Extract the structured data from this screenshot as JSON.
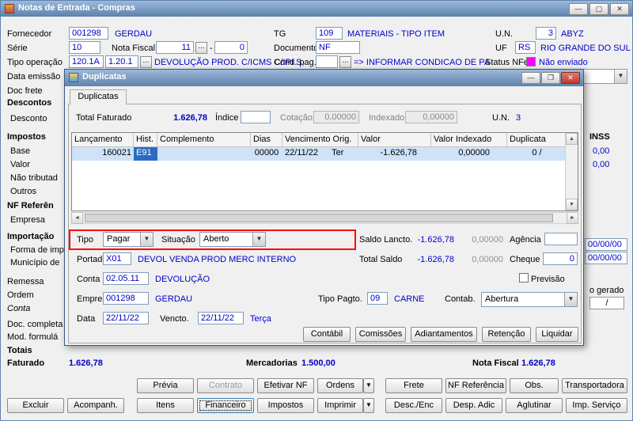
{
  "icons": {
    "dropdown": "▼",
    "browse": "...",
    "minimize": "—",
    "maximize": "▢",
    "restore": "❐",
    "close": "✕",
    "scroll_up": "▲",
    "scroll_down": "▼",
    "scroll_left": "◄",
    "scroll_right": "►"
  },
  "colors": {
    "titlebar": "#5c82ad",
    "value_blue": "#0000cc",
    "status_nfe_magenta": "#ff00ff",
    "grid_selection": "#cfe2f7",
    "annotation_red": "#ff0000"
  },
  "window": {
    "title": "Notas de Entrada - Compras"
  },
  "header": {
    "fornecedor_label": "Fornecedor",
    "fornecedor_code": "001298",
    "fornecedor_name": "GERDAU",
    "tg_label": "TG",
    "tg_code": "109",
    "tg_desc": "MATERIAIS - TIPO ITEM",
    "un_label": "U.N.",
    "un_code": "3",
    "un_desc": "ABYZ",
    "serie_label": "Série",
    "serie_value": "10",
    "nf_label": "Nota Fiscal",
    "nf_value": "11",
    "nf_sep": "-",
    "nf_value2": "0",
    "documento_label": "Documento",
    "documento_value": "NF",
    "uf_label": "UF",
    "uf_code": "RS",
    "uf_desc": "RIO GRANDE DO SUL",
    "tipo_op_label": "Tipo operação",
    "tipo_op_code1": "120.1A",
    "tipo_op_code2": "1.20.1",
    "tipo_op_desc": "DEVOLUÇÃO PROD. C/ICMS C/IPI S,",
    "cond_pag_label": "Cond. pag.",
    "cond_pag_desc": "=> INFORMAR CONDICAO DE PA",
    "status_nfe_label": "Status NFe",
    "status_nfe_value": "Não enviado",
    "data_emissao_label": "Data emissão",
    "doc_frete_label": "Doc frete"
  },
  "sidebar": {
    "descontos": "Descontos",
    "desconto": "Desconto",
    "impostos": "Impostos",
    "base": "Base",
    "valor": "Valor",
    "nao_tributad": "Não tributad",
    "outros": "Outros",
    "nf_referen": "NF Referên",
    "empresa": "Empresa",
    "importacao": "Importação",
    "forma_imp": "Forma de imp",
    "municipio": "Município de",
    "remessa": "Remessa",
    "ordem": "Ordem",
    "conta": "Conta",
    "doc_completa": "Doc. completa",
    "mod_formula": "Mod. formulá"
  },
  "right_edge": {
    "inss": "INSS",
    "val1": "0,00",
    "val2": "0,00",
    "date1": "00/00/00",
    "date2": "00/00/00",
    "gerado": "o gerado",
    "slash": "/"
  },
  "totals": {
    "totais": "Totais",
    "faturado_label": "Faturado",
    "faturado_value": "1.626,78",
    "mercadorias_label": "Mercadorias",
    "mercadorias_value": "1.500,00",
    "nota_fiscal_label": "Nota Fiscal",
    "nota_fiscal_value": "1.626,78"
  },
  "buttons_row1": [
    {
      "label": "Prévia"
    },
    {
      "label": "Contrato",
      "disabled": true
    },
    {
      "label": "Efetivar NF"
    },
    {
      "label": "Ordens",
      "split": true
    },
    {
      "label": "Frete"
    },
    {
      "label": "NF Referência"
    },
    {
      "label": "Obs."
    },
    {
      "label": "Transportadora"
    }
  ],
  "buttons_row2": [
    {
      "label": "Excluir"
    },
    {
      "label": "Acompanh."
    },
    {
      "label": "Itens"
    },
    {
      "label": "Financeiro",
      "focused": true
    },
    {
      "label": "Impostos"
    },
    {
      "label": "Imprimir",
      "split": true
    },
    {
      "label": "Desc./Enc"
    },
    {
      "label": "Desp. Adic"
    },
    {
      "label": "Aglutinar"
    },
    {
      "label": "Imp. Serviço"
    }
  ],
  "dialog": {
    "title": "Duplicatas",
    "tab": "Duplicatas",
    "summary": {
      "total_faturado_label": "Total Faturado",
      "total_faturado_value": "1.626,78",
      "indice_label": "Índice",
      "indice_value": "",
      "cotacao_label": "Cotação",
      "cotacao_value": "0,00000",
      "indexado_label": "Indexado",
      "indexado_value": "0,00000",
      "un_label": "U.N.",
      "un_value": "3"
    },
    "grid": {
      "columns": [
        "Lançamento",
        "Hist.",
        "Complemento",
        "Dias",
        "Vencimento Orig.",
        "Valor",
        "Valor Indexado",
        "Duplicata"
      ],
      "row": {
        "lancamento": "160021",
        "hist": "E91",
        "complemento": "",
        "dias": "00000",
        "vencimento": "22/11/22",
        "weekday": "Ter",
        "valor": "-1.626,78",
        "valor_indexado": "0,00000",
        "duplicata": "0 /"
      }
    },
    "form": {
      "tipo_label": "Tipo",
      "tipo_value": "Pagar",
      "situacao_label": "Situação",
      "situacao_value": "Aberto",
      "saldo_lancto_label": "Saldo Lancto.",
      "saldo_lancto_value": "-1.626,78",
      "saldo_lancto_indexado": "0,00000",
      "agencia_label": "Agência",
      "agencia_value": "",
      "portador_label": "Portador",
      "portador_code": "X01",
      "portador_desc": "DEVOL VENDA PROD MERC INTERNO",
      "total_saldo_label": "Total Saldo",
      "total_saldo_value": "-1.626,78",
      "total_saldo_indexado": "0,00000",
      "cheque_label": "Cheque",
      "cheque_value": "0",
      "conta_label": "Conta",
      "conta_code": "02.05.11",
      "conta_desc": "DEVOLUÇÃO",
      "previsao_label": "Previsão",
      "empresa_label": "Empresa",
      "empresa_code": "001298",
      "empresa_desc": "GERDAU",
      "tipo_pagto_label": "Tipo Pagto.",
      "tipo_pagto_code": "09",
      "tipo_pagto_desc": "CARNE",
      "contab_label": "Contab.",
      "contab_value": "Abertura",
      "data_label": "Data",
      "data_value": "22/11/22",
      "vencto_label": "Vencto.",
      "vencto_value": "22/11/22",
      "vencto_weekday": "Terça"
    },
    "buttons": [
      {
        "label": "Contábil"
      },
      {
        "label": "Comissões"
      },
      {
        "label": "Adiantamentos"
      },
      {
        "label": "Retenção"
      },
      {
        "label": "Liquidar"
      }
    ]
  }
}
